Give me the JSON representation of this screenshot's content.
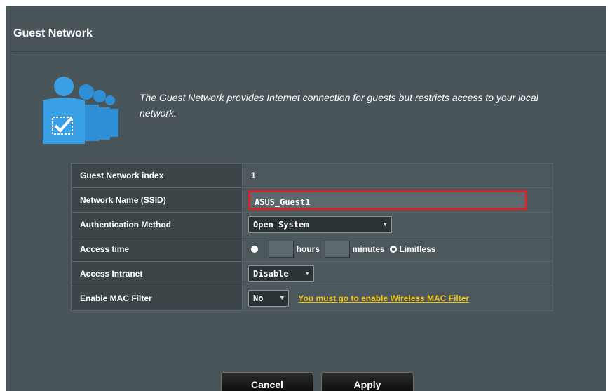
{
  "page": {
    "title": "Guest Network",
    "description": "The Guest Network provides Internet connection for guests but restricts access to your local network.",
    "icon": "guest-people-icon"
  },
  "settings": {
    "index": {
      "label": "Guest Network index",
      "value": "1"
    },
    "ssid": {
      "label": "Network Name (SSID)",
      "value": "ASUS_Guest1"
    },
    "auth": {
      "label": "Authentication Method",
      "value": "Open System"
    },
    "access_time": {
      "label": "Access time",
      "hours_label": "hours",
      "minutes_label": "minutes",
      "limitless_label": "Limitless",
      "selected": "Limitless"
    },
    "intranet": {
      "label": "Access Intranet",
      "value": "Disable"
    },
    "mac_filter": {
      "label": "Enable MAC Filter",
      "value": "No",
      "link_text": "You must go to enable Wireless MAC Filter"
    }
  },
  "buttons": {
    "cancel": "Cancel",
    "apply": "Apply"
  },
  "colors": {
    "panel_bg": "#4a5559",
    "highlight_border": "#d8232b",
    "link": "#f1c40f",
    "icon_blue": "#2e8fd6"
  }
}
